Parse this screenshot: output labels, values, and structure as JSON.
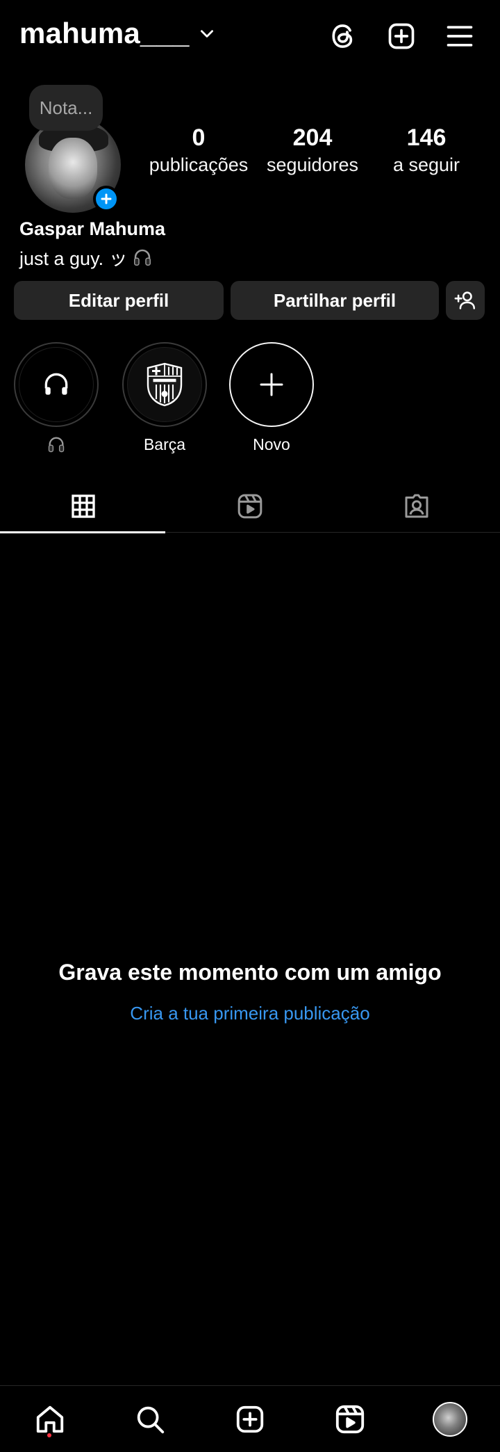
{
  "header": {
    "username": "mahuma___",
    "icons": [
      "threads-icon",
      "create-icon",
      "menu-icon"
    ]
  },
  "profile": {
    "note_placeholder": "Nota...",
    "stats": {
      "posts": {
        "value": "0",
        "label": "publicações"
      },
      "followers": {
        "value": "204",
        "label": "seguidores"
      },
      "following": {
        "value": "146",
        "label": "a seguir"
      }
    },
    "full_name": "Gaspar Mahuma",
    "bio": "just a guy. ッ"
  },
  "actions": {
    "edit_label": "Editar perfil",
    "share_label": "Partilhar perfil"
  },
  "highlights": [
    {
      "label": "",
      "icon": "headphones-icon"
    },
    {
      "label": "Barça",
      "icon": "fcb-crest-icon"
    },
    {
      "label": "Novo",
      "icon": "plus-icon"
    }
  ],
  "tabs": [
    "grid-icon",
    "reels-icon",
    "tagged-icon"
  ],
  "empty_state": {
    "title": "Grava este momento com um amigo",
    "link": "Cria a tua primeira publicação"
  },
  "bottom_nav": [
    "home-icon",
    "search-icon",
    "create-icon",
    "reels-icon",
    "profile-avatar"
  ],
  "colors": {
    "background": "#000000",
    "button_bg": "#262626",
    "link": "#3897f0",
    "badge": "#0095f6",
    "notification_dot": "#ff3040"
  }
}
